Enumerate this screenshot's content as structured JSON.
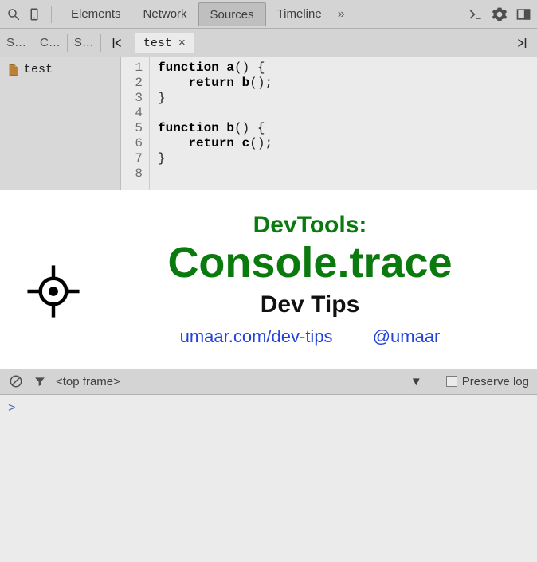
{
  "toolbar": {
    "tabs": [
      "Elements",
      "Network",
      "Sources",
      "Timeline"
    ],
    "active_tab": "Sources",
    "overflow": "»"
  },
  "subbar": {
    "minis": [
      "S…",
      "C…",
      "S…"
    ],
    "filetab_name": "test",
    "filetab_close": "×"
  },
  "sidebar": {
    "file_name": "test"
  },
  "code": {
    "line_numbers": [
      "1",
      "2",
      "3",
      "4",
      "5",
      "6",
      "7",
      "8"
    ],
    "lines": [
      {
        "kw": "function ",
        "fn": "a",
        "rest": "() {"
      },
      {
        "indent": "    ",
        "kw": "return ",
        "fn": "b",
        "rest": "();"
      },
      {
        "rest": "}"
      },
      {
        "rest": ""
      },
      {
        "kw": "function ",
        "fn": "b",
        "rest": "() {"
      },
      {
        "indent": "    ",
        "kw": "return ",
        "fn": "c",
        "rest": "();"
      },
      {
        "rest": "}"
      },
      {
        "rest": ""
      }
    ]
  },
  "consolebar": {
    "frame_text": "<top frame>",
    "preserve_label": "Preserve log"
  },
  "console": {
    "prompt": ">"
  },
  "overlay": {
    "line1": "DevTools:",
    "line2": "Console.trace",
    "line3": "Dev Tips",
    "link1": "umaar.com/dev-tips",
    "link2": "@umaar"
  }
}
